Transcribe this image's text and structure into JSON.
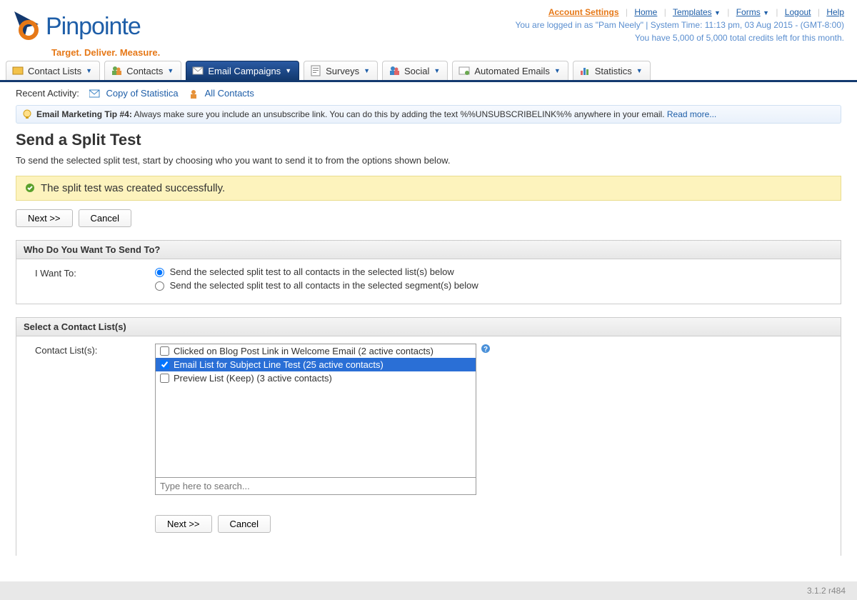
{
  "brand": {
    "name": "Pinpointe",
    "tagline": "Target. Deliver. Measure."
  },
  "topnav": {
    "account_settings": "Account Settings",
    "home": "Home",
    "templates": "Templates",
    "forms": "Forms",
    "logout": "Logout",
    "help": "Help"
  },
  "meta": {
    "logged_in": "You are logged in as \"Pam Neely\" | System Time: 11:13 pm, 03 Aug 2015 - (GMT-8:00)",
    "credits": "You have 5,000 of 5,000 total credits left for this month."
  },
  "tabs": {
    "contact_lists": "Contact Lists",
    "contacts": "Contacts",
    "email_campaigns": "Email Campaigns",
    "surveys": "Surveys",
    "social": "Social",
    "automated_emails": "Automated Emails",
    "statistics": "Statistics"
  },
  "recent": {
    "label": "Recent Activity:",
    "item1": "Copy of Statistica",
    "item2": "All Contacts"
  },
  "tip": {
    "prefix": "Email Marketing Tip #4:",
    "body": " Always make sure you include an unsubscribe link. You can do this by adding the text %%UNSUBSCRIBELINK%% anywhere in your email. ",
    "read_more": "Read more..."
  },
  "page": {
    "title": "Send a Split Test",
    "desc": "To send the selected split test, start by choosing who you want to send it to from the options shown below.",
    "success": "The split test was created successfully."
  },
  "buttons": {
    "next": "Next >>",
    "cancel": "Cancel"
  },
  "send_to": {
    "header": "Who Do You Want To Send To?",
    "label": "I Want To:",
    "opt_lists": "Send the selected split test to all contacts in the selected list(s) below",
    "opt_segments": "Send the selected split test to all contacts in the selected segment(s) below"
  },
  "contact_list": {
    "header": "Select a Contact List(s)",
    "label": "Contact List(s):",
    "items": [
      {
        "label": "Clicked on Blog Post Link in Welcome Email (2 active contacts)",
        "selected": false
      },
      {
        "label": "Email List for Subject Line Test (25 active contacts)",
        "selected": true
      },
      {
        "label": "Preview List (Keep) (3 active contacts)",
        "selected": false
      }
    ],
    "search_placeholder": "Type here to search..."
  },
  "footer": {
    "version": "3.1.2 r484"
  }
}
